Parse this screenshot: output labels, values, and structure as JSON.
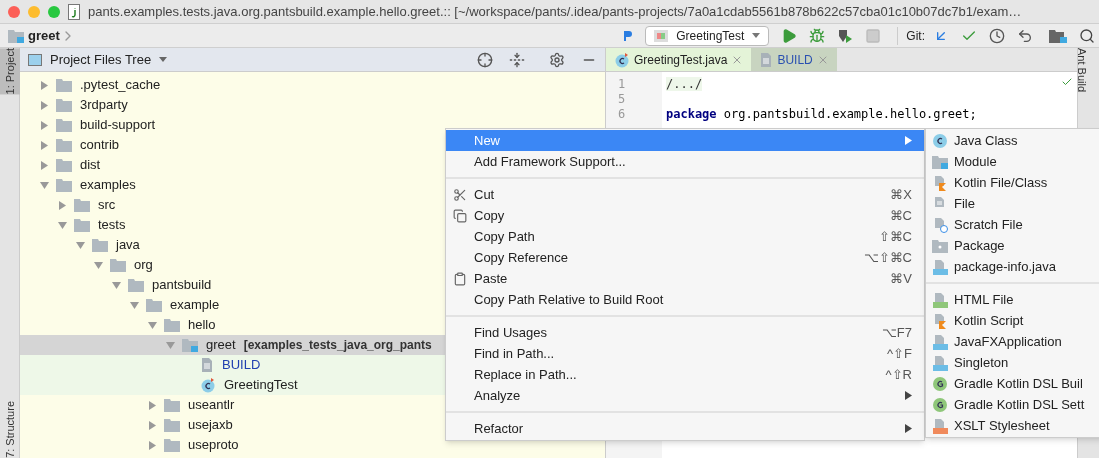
{
  "window": {
    "title": "pants.examples.tests.java.org.pantsbuild.example.hello.greet.:: [~/workspace/pants/.idea/pants-projects/7a0a1cdab5561b878b622c57cba01c10b07dc7b1/exam…"
  },
  "toolbar": {
    "breadcrumb": "greet",
    "run_config": "GreetingTest",
    "git_label": "Git:"
  },
  "left_stripe": [
    {
      "label": "1: Project",
      "selected": true
    },
    {
      "label": "7: Structure",
      "selected": false
    }
  ],
  "right_stripe": [
    {
      "label": "Ant Build"
    }
  ],
  "project_panel": {
    "view": "Project Files Tree",
    "tree": [
      {
        "kind": "folder",
        "name": ".pytest_cache",
        "expanded": false
      },
      {
        "kind": "folder",
        "name": "3rdparty",
        "expanded": false
      },
      {
        "kind": "folder",
        "name": "build-support",
        "expanded": false
      },
      {
        "kind": "folder",
        "name": "contrib",
        "expanded": false
      },
      {
        "kind": "folder",
        "name": "dist",
        "expanded": false
      },
      {
        "kind": "folder",
        "name": "examples",
        "expanded": true,
        "children": [
          {
            "kind": "folder",
            "name": "src",
            "expanded": false
          },
          {
            "kind": "folder",
            "name": "tests",
            "expanded": true,
            "children": [
              {
                "kind": "folder",
                "name": "java",
                "expanded": true,
                "children": [
                  {
                    "kind": "folder",
                    "name": "org",
                    "expanded": true,
                    "children": [
                      {
                        "kind": "folder",
                        "name": "pantsbuild",
                        "expanded": true,
                        "children": [
                          {
                            "kind": "folder",
                            "name": "example",
                            "expanded": true,
                            "children": [
                              {
                                "kind": "folder",
                                "name": "hello",
                                "expanded": true,
                                "children": [
                                  {
                                    "kind": "module",
                                    "name": "greet",
                                    "note": "[examples_tests_java_org_pants",
                                    "expanded": true,
                                    "selected": true,
                                    "children": [
                                      {
                                        "kind": "build",
                                        "name": "BUILD"
                                      },
                                      {
                                        "kind": "class",
                                        "name": "GreetingTest"
                                      }
                                    ]
                                  }
                                ]
                              },
                              {
                                "kind": "folder",
                                "name": "useantlr",
                                "expanded": false
                              },
                              {
                                "kind": "folder",
                                "name": "usejaxb",
                                "expanded": false
                              },
                              {
                                "kind": "folder",
                                "name": "useproto",
                                "expanded": false
                              }
                            ]
                          }
                        ]
                      }
                    ]
                  }
                ]
              }
            ]
          }
        ]
      }
    ]
  },
  "editor": {
    "tabs": [
      {
        "label": "GreetingTest.java",
        "kind": "class",
        "selected": true
      },
      {
        "label": "BUILD",
        "kind": "build",
        "selected": false
      }
    ],
    "lines": [
      {
        "number": "1",
        "kind": "fold",
        "text": "/.../"
      },
      {
        "number": "5",
        "kind": "blank"
      },
      {
        "number": "6",
        "kind": "package",
        "keyword": "package",
        "text": "org.pantsbuild.example.hello.greet;"
      }
    ]
  },
  "context_menu": {
    "sections": [
      [
        {
          "label": "New",
          "kind": "plain",
          "submenu": true,
          "selected": true
        },
        {
          "label": "Add Framework Support...",
          "kind": "plain",
          "submenu": false,
          "selected": false
        }
      ],
      [
        {
          "label": "Cut",
          "kind": "cut",
          "shortcut": "⌘X",
          "submenu": false,
          "selected": false
        },
        {
          "label": "Copy",
          "kind": "copy",
          "shortcut": "⌘C",
          "submenu": false,
          "selected": false
        },
        {
          "label": "Copy Path",
          "kind": "plain",
          "shortcut": "⇧⌘C",
          "submenu": false,
          "selected": false
        },
        {
          "label": "Copy Reference",
          "kind": "plain",
          "shortcut": "⌥⇧⌘C",
          "submenu": false,
          "selected": false
        },
        {
          "label": "Paste",
          "kind": "paste",
          "shortcut": "⌘V",
          "submenu": false,
          "selected": false
        },
        {
          "label": "Copy Path Relative to Build Root",
          "kind": "plain",
          "submenu": false,
          "selected": false
        }
      ],
      [
        {
          "label": "Find Usages",
          "kind": "plain",
          "shortcut": "⌥F7",
          "submenu": false,
          "selected": false
        },
        {
          "label": "Find in Path...",
          "kind": "plain",
          "shortcut": "^⇧F",
          "submenu": false,
          "selected": false
        },
        {
          "label": "Replace in Path...",
          "kind": "plain",
          "shortcut": "^⇧R",
          "submenu": false,
          "selected": false
        },
        {
          "label": "Analyze",
          "kind": "plain",
          "submenu": true,
          "selected": false
        }
      ],
      [
        {
          "label": "Refactor",
          "kind": "plain",
          "submenu": true,
          "selected": false
        }
      ]
    ]
  },
  "new_submenu": {
    "sections": [
      [
        {
          "label": "Java Class",
          "kind": "class"
        },
        {
          "label": "Module",
          "kind": "module"
        },
        {
          "label": "Kotlin File/Class",
          "kind": "kotlin"
        },
        {
          "label": "File",
          "kind": "file"
        },
        {
          "label": "Scratch File",
          "kind": "scratch"
        },
        {
          "label": "Package",
          "kind": "package"
        },
        {
          "label": "package-info.java",
          "kind": "java"
        }
      ],
      [
        {
          "label": "HTML File",
          "kind": "html"
        },
        {
          "label": "Kotlin Script",
          "kind": "kotlin"
        },
        {
          "label": "JavaFXApplication",
          "kind": "java"
        },
        {
          "label": "Singleton",
          "kind": "java"
        },
        {
          "label": "Gradle Kotlin DSL Buil",
          "kind": "gradle"
        },
        {
          "label": "Gradle Kotlin DSL Sett",
          "kind": "gradle"
        },
        {
          "label": "XSLT Stylesheet",
          "kind": "xslt"
        }
      ]
    ]
  }
}
